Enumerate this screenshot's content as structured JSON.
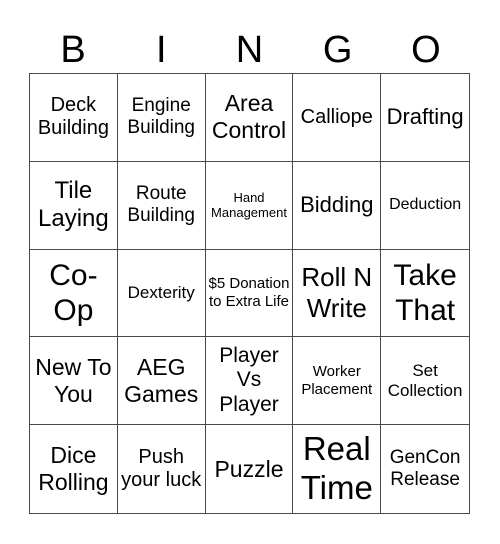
{
  "header": [
    "B",
    "I",
    "N",
    "G",
    "O"
  ],
  "cells": [
    "Deck Building",
    "Engine Building",
    "Area Control",
    "Calliope",
    "Drafting",
    "Tile Laying",
    "Route Building",
    "Hand Management",
    "Bidding",
    "Deduction",
    "Co-Op",
    "Dexterity",
    "$5 Donation to Extra Life",
    "Roll N Write",
    "Take That",
    "New To You",
    "AEG Games",
    "Player Vs Player",
    "Worker Placement",
    "Set Collection",
    "Dice Rolling",
    "Push your luck",
    "Puzzle",
    "Real Time",
    "GenCon Release"
  ]
}
